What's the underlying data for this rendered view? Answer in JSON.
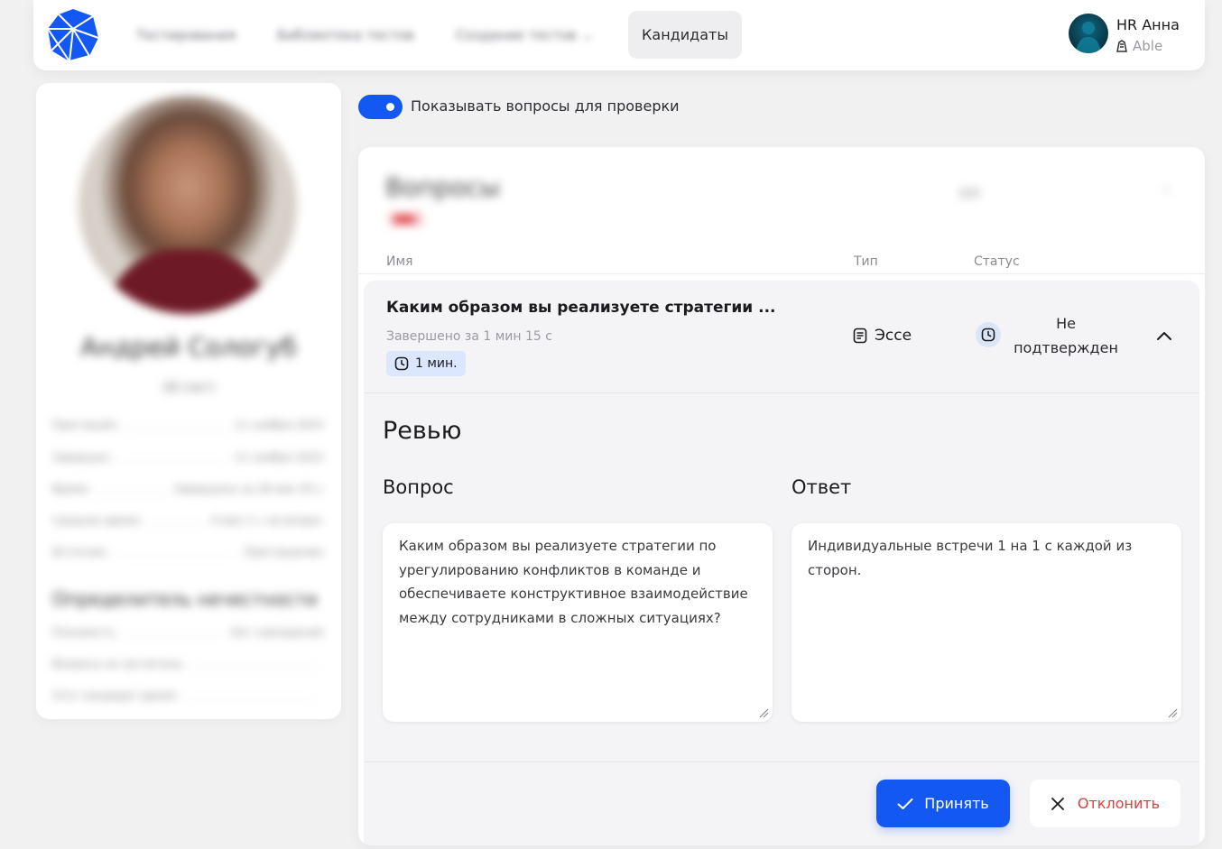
{
  "header": {
    "nav_blurred": [
      "Тестирования",
      "Библиотека тестов",
      "Создание тестов"
    ],
    "nav_active": "Кандидаты",
    "user_name": "HR Анна",
    "user_org": "Able"
  },
  "profile": {
    "name": "Андрей Сологуб",
    "subtitle": "28 (лет)",
    "rows": [
      {
        "label": "Приглашён",
        "value": "11 ноября 2024"
      },
      {
        "label": "Завершил",
        "value": "11 ноября 2024"
      },
      {
        "label": "Время",
        "value": "Завершено за 28 мин 45 с"
      },
      {
        "label": "Среднее время",
        "value": "4 мин 1 с на вопрос"
      },
      {
        "label": "Источник",
        "value": "Приглашение"
      }
    ],
    "section_title": "Определитель нечестности",
    "section_rows": [
      {
        "label": "Похожесть",
        "value": "Нет совпадений"
      },
      {
        "label": "Вопросы не засчитаны",
        "value": ""
      },
      {
        "label": "Этот кандидат время",
        "value": ""
      }
    ]
  },
  "toggle": {
    "label": "Показывать вопросы для проверки",
    "on": true
  },
  "questions_panel": {
    "title_blurred": "Вопросы",
    "right_blurred": "0/0",
    "columns": {
      "name": "Имя",
      "type": "Тип",
      "status": "Статус"
    },
    "question": {
      "title": "Каким образом вы реализуете стратегии ...",
      "completed": "Завершено за 1 мин 15 с",
      "time_limit": "1 мин.",
      "type": "Эссе",
      "status": "Не подтвержден"
    },
    "review": {
      "title": "Ревью",
      "question_label": "Вопрос",
      "answer_label": "Ответ",
      "question_text": "Каким образом вы реализуете стратегии по урегулированию конфликтов в команде и обеспечиваете конструктивное взаимодействие между сотрудниками в сложных ситуациях?",
      "answer_text": "Индивидуальные встречи 1 на 1 с каждой из сторон."
    },
    "actions": {
      "accept": "Принять",
      "reject": "Отклонить"
    }
  },
  "colors": {
    "accent": "#1458f4",
    "reject": "#e43b3b",
    "timer_bg": "#dbe7fe"
  }
}
